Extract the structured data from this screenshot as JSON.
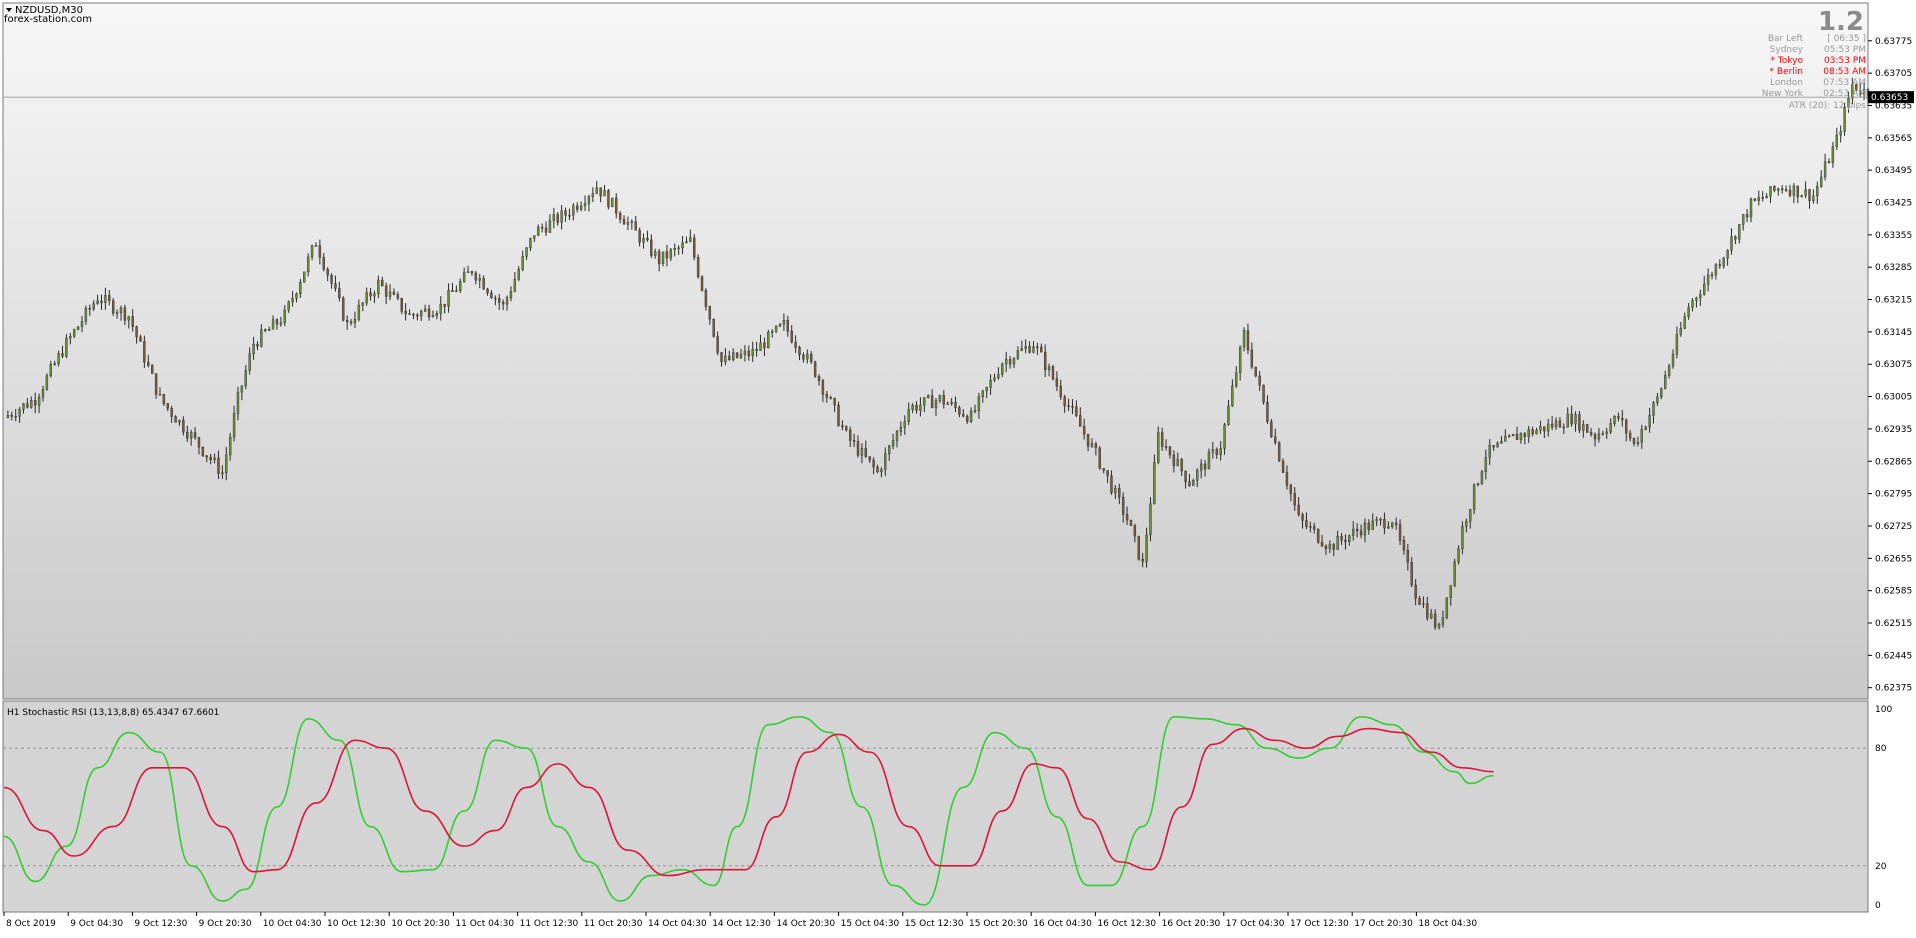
{
  "header": {
    "symbol": "NZDUSD,M30",
    "watermark": "forex-station.com"
  },
  "info_panel": {
    "version": "1.2",
    "rows": [
      {
        "label": "Bar Left",
        "value": "[ 06:35 ]",
        "color": "#9a9a9a"
      },
      {
        "label": "Sydney",
        "value": "05:53 PM",
        "color": "#9a9a9a"
      },
      {
        "label": "* Tokyo",
        "value": "03:53 PM",
        "color": "#ff0000"
      },
      {
        "label": "* Berlin",
        "value": "08:53 AM",
        "color": "#ff0000"
      },
      {
        "label": "London",
        "value": "07:53 AM",
        "color": "#9a9a9a"
      },
      {
        "label": "New York",
        "value": "02:53 AM",
        "color": "#9a9a9a"
      }
    ],
    "atr": "ATR (20): 12 pips"
  },
  "current_price": "0.63653",
  "indicator": {
    "label": "H1 Stochastic RSI (13,13,8,8) 65.4347 67.6601"
  },
  "colors": {
    "bull": "#6b8e3a",
    "bear": "#7a5a3a",
    "wick": "#2a2a2a",
    "stoch_k": "#32cd32",
    "stoch_d": "#dc143c",
    "grid": "#8a8a8a"
  },
  "chart_data": [
    {
      "type": "candlestick",
      "title": "NZDUSD,M30",
      "y_ticks": [
        "0.63775",
        "0.63705",
        "0.63635",
        "0.63565",
        "0.63495",
        "0.63425",
        "0.63355",
        "0.63285",
        "0.63215",
        "0.63145",
        "0.63075",
        "0.63005",
        "0.62935",
        "0.62865",
        "0.62795",
        "0.62725",
        "0.62655",
        "0.62585",
        "0.62515",
        "0.62445",
        "0.62375"
      ],
      "ylim": [
        0.6237,
        0.6382
      ],
      "x_labels": [
        "8 Oct 2019",
        "9 Oct 04:30",
        "9 Oct 12:30",
        "9 Oct 20:30",
        "10 Oct 04:30",
        "10 Oct 12:30",
        "10 Oct 20:30",
        "11 Oct 04:30",
        "11 Oct 12:30",
        "11 Oct 20:30",
        "14 Oct 04:30",
        "14 Oct 12:30",
        "14 Oct 20:30",
        "15 Oct 04:30",
        "15 Oct 12:30",
        "15 Oct 20:30",
        "16 Oct 04:30",
        "16 Oct 12:30",
        "16 Oct 20:30",
        "17 Oct 04:30",
        "17 Oct 12:30",
        "17 Oct 20:30",
        "18 Oct 04:30"
      ],
      "close_path": [
        [
          0,
          0.6296
        ],
        [
          8,
          0.63
        ],
        [
          16,
          0.6312
        ],
        [
          24,
          0.6322
        ],
        [
          32,
          0.6318
        ],
        [
          40,
          0.63
        ],
        [
          48,
          0.6292
        ],
        [
          56,
          0.6284
        ],
        [
          60,
          0.63
        ],
        [
          64,
          0.6312
        ],
        [
          72,
          0.6318
        ],
        [
          80,
          0.6334
        ],
        [
          88,
          0.6316
        ],
        [
          96,
          0.6325
        ],
        [
          104,
          0.6318
        ],
        [
          112,
          0.632
        ],
        [
          120,
          0.6328
        ],
        [
          128,
          0.632
        ],
        [
          136,
          0.6336
        ],
        [
          144,
          0.634
        ],
        [
          152,
          0.6346
        ],
        [
          160,
          0.6338
        ],
        [
          168,
          0.633
        ],
        [
          176,
          0.6334
        ],
        [
          184,
          0.6308
        ],
        [
          192,
          0.631
        ],
        [
          200,
          0.6316
        ],
        [
          208,
          0.6306
        ],
        [
          216,
          0.6292
        ],
        [
          224,
          0.6284
        ],
        [
          232,
          0.6298
        ],
        [
          240,
          0.63
        ],
        [
          248,
          0.6296
        ],
        [
          256,
          0.6308
        ],
        [
          264,
          0.6312
        ],
        [
          272,
          0.63
        ],
        [
          280,
          0.6288
        ],
        [
          288,
          0.6274
        ],
        [
          292,
          0.6264
        ],
        [
          296,
          0.6292
        ],
        [
          304,
          0.6282
        ],
        [
          312,
          0.629
        ],
        [
          318,
          0.6314
        ],
        [
          324,
          0.6296
        ],
        [
          332,
          0.6274
        ],
        [
          340,
          0.6268
        ],
        [
          348,
          0.6272
        ],
        [
          356,
          0.6274
        ],
        [
          362,
          0.6258
        ],
        [
          368,
          0.625
        ],
        [
          374,
          0.6272
        ],
        [
          380,
          0.6288
        ],
        [
          388,
          0.6292
        ],
        [
          396,
          0.6294
        ],
        [
          402,
          0.6296
        ],
        [
          408,
          0.6292
        ],
        [
          414,
          0.6296
        ],
        [
          418,
          0.629
        ],
        [
          424,
          0.63
        ],
        [
          432,
          0.632
        ],
        [
          440,
          0.633
        ],
        [
          448,
          0.6342
        ],
        [
          456,
          0.6346
        ],
        [
          464,
          0.6344
        ],
        [
          470,
          0.6356
        ],
        [
          474,
          0.6368
        ],
        [
          478,
          0.6366
        ]
      ],
      "x_count": 480
    },
    {
      "type": "line",
      "title": "H1 Stochastic RSI (13,13,8,8) 65.4347 67.6601",
      "y_ticks": [
        100,
        80,
        20,
        0
      ],
      "ylim": [
        0,
        100
      ],
      "x_count": 480,
      "series": [
        {
          "key": "k",
          "points": [
            [
              0,
              35
            ],
            [
              8,
              12
            ],
            [
              16,
              30
            ],
            [
              24,
              70
            ],
            [
              32,
              88
            ],
            [
              40,
              78
            ],
            [
              48,
              20
            ],
            [
              56,
              2
            ],
            [
              62,
              8
            ],
            [
              70,
              50
            ],
            [
              78,
              95
            ],
            [
              86,
              84
            ],
            [
              94,
              40
            ],
            [
              102,
              17
            ],
            [
              110,
              18
            ],
            [
              118,
              48
            ],
            [
              126,
              84
            ],
            [
              134,
              80
            ],
            [
              142,
              40
            ],
            [
              150,
              22
            ],
            [
              158,
              2
            ],
            [
              166,
              15
            ],
            [
              174,
              18
            ],
            [
              182,
              10
            ],
            [
              188,
              40
            ],
            [
              196,
              92
            ],
            [
              204,
              96
            ],
            [
              212,
              88
            ],
            [
              220,
              50
            ],
            [
              228,
              10
            ],
            [
              236,
              0
            ],
            [
              246,
              60
            ],
            [
              254,
              88
            ],
            [
              262,
              80
            ],
            [
              270,
              45
            ],
            [
              278,
              10
            ],
            [
              284,
              10
            ],
            [
              292,
              40
            ],
            [
              300,
              96
            ],
            [
              308,
              95
            ],
            [
              316,
              92
            ],
            [
              324,
              80
            ],
            [
              332,
              75
            ],
            [
              340,
              80
            ],
            [
              348,
              96
            ],
            [
              356,
              92
            ],
            [
              364,
              78
            ],
            [
              372,
              68
            ],
            [
              376,
              62
            ],
            [
              382,
              66
            ]
          ]
        },
        {
          "key": "d",
          "points": [
            [
              0,
              60
            ],
            [
              10,
              38
            ],
            [
              18,
              25
            ],
            [
              28,
              40
            ],
            [
              38,
              70
            ],
            [
              46,
              70
            ],
            [
              56,
              40
            ],
            [
              64,
              17
            ],
            [
              70,
              18
            ],
            [
              80,
              52
            ],
            [
              90,
              84
            ],
            [
              98,
              80
            ],
            [
              108,
              48
            ],
            [
              118,
              30
            ],
            [
              126,
              38
            ],
            [
              134,
              60
            ],
            [
              142,
              72
            ],
            [
              150,
              60
            ],
            [
              160,
              28
            ],
            [
              170,
              15
            ],
            [
              180,
              18
            ],
            [
              190,
              18
            ],
            [
              198,
              45
            ],
            [
              206,
              78
            ],
            [
              214,
              87
            ],
            [
              222,
              78
            ],
            [
              232,
              40
            ],
            [
              240,
              20
            ],
            [
              248,
              20
            ],
            [
              256,
              48
            ],
            [
              264,
              72
            ],
            [
              270,
              70
            ],
            [
              278,
              44
            ],
            [
              286,
              22
            ],
            [
              294,
              18
            ],
            [
              302,
              50
            ],
            [
              310,
              82
            ],
            [
              318,
              90
            ],
            [
              326,
              84
            ],
            [
              334,
              80
            ],
            [
              342,
              86
            ],
            [
              350,
              90
            ],
            [
              358,
              88
            ],
            [
              366,
              78
            ],
            [
              374,
              70
            ],
            [
              382,
              68
            ]
          ]
        }
      ]
    }
  ]
}
